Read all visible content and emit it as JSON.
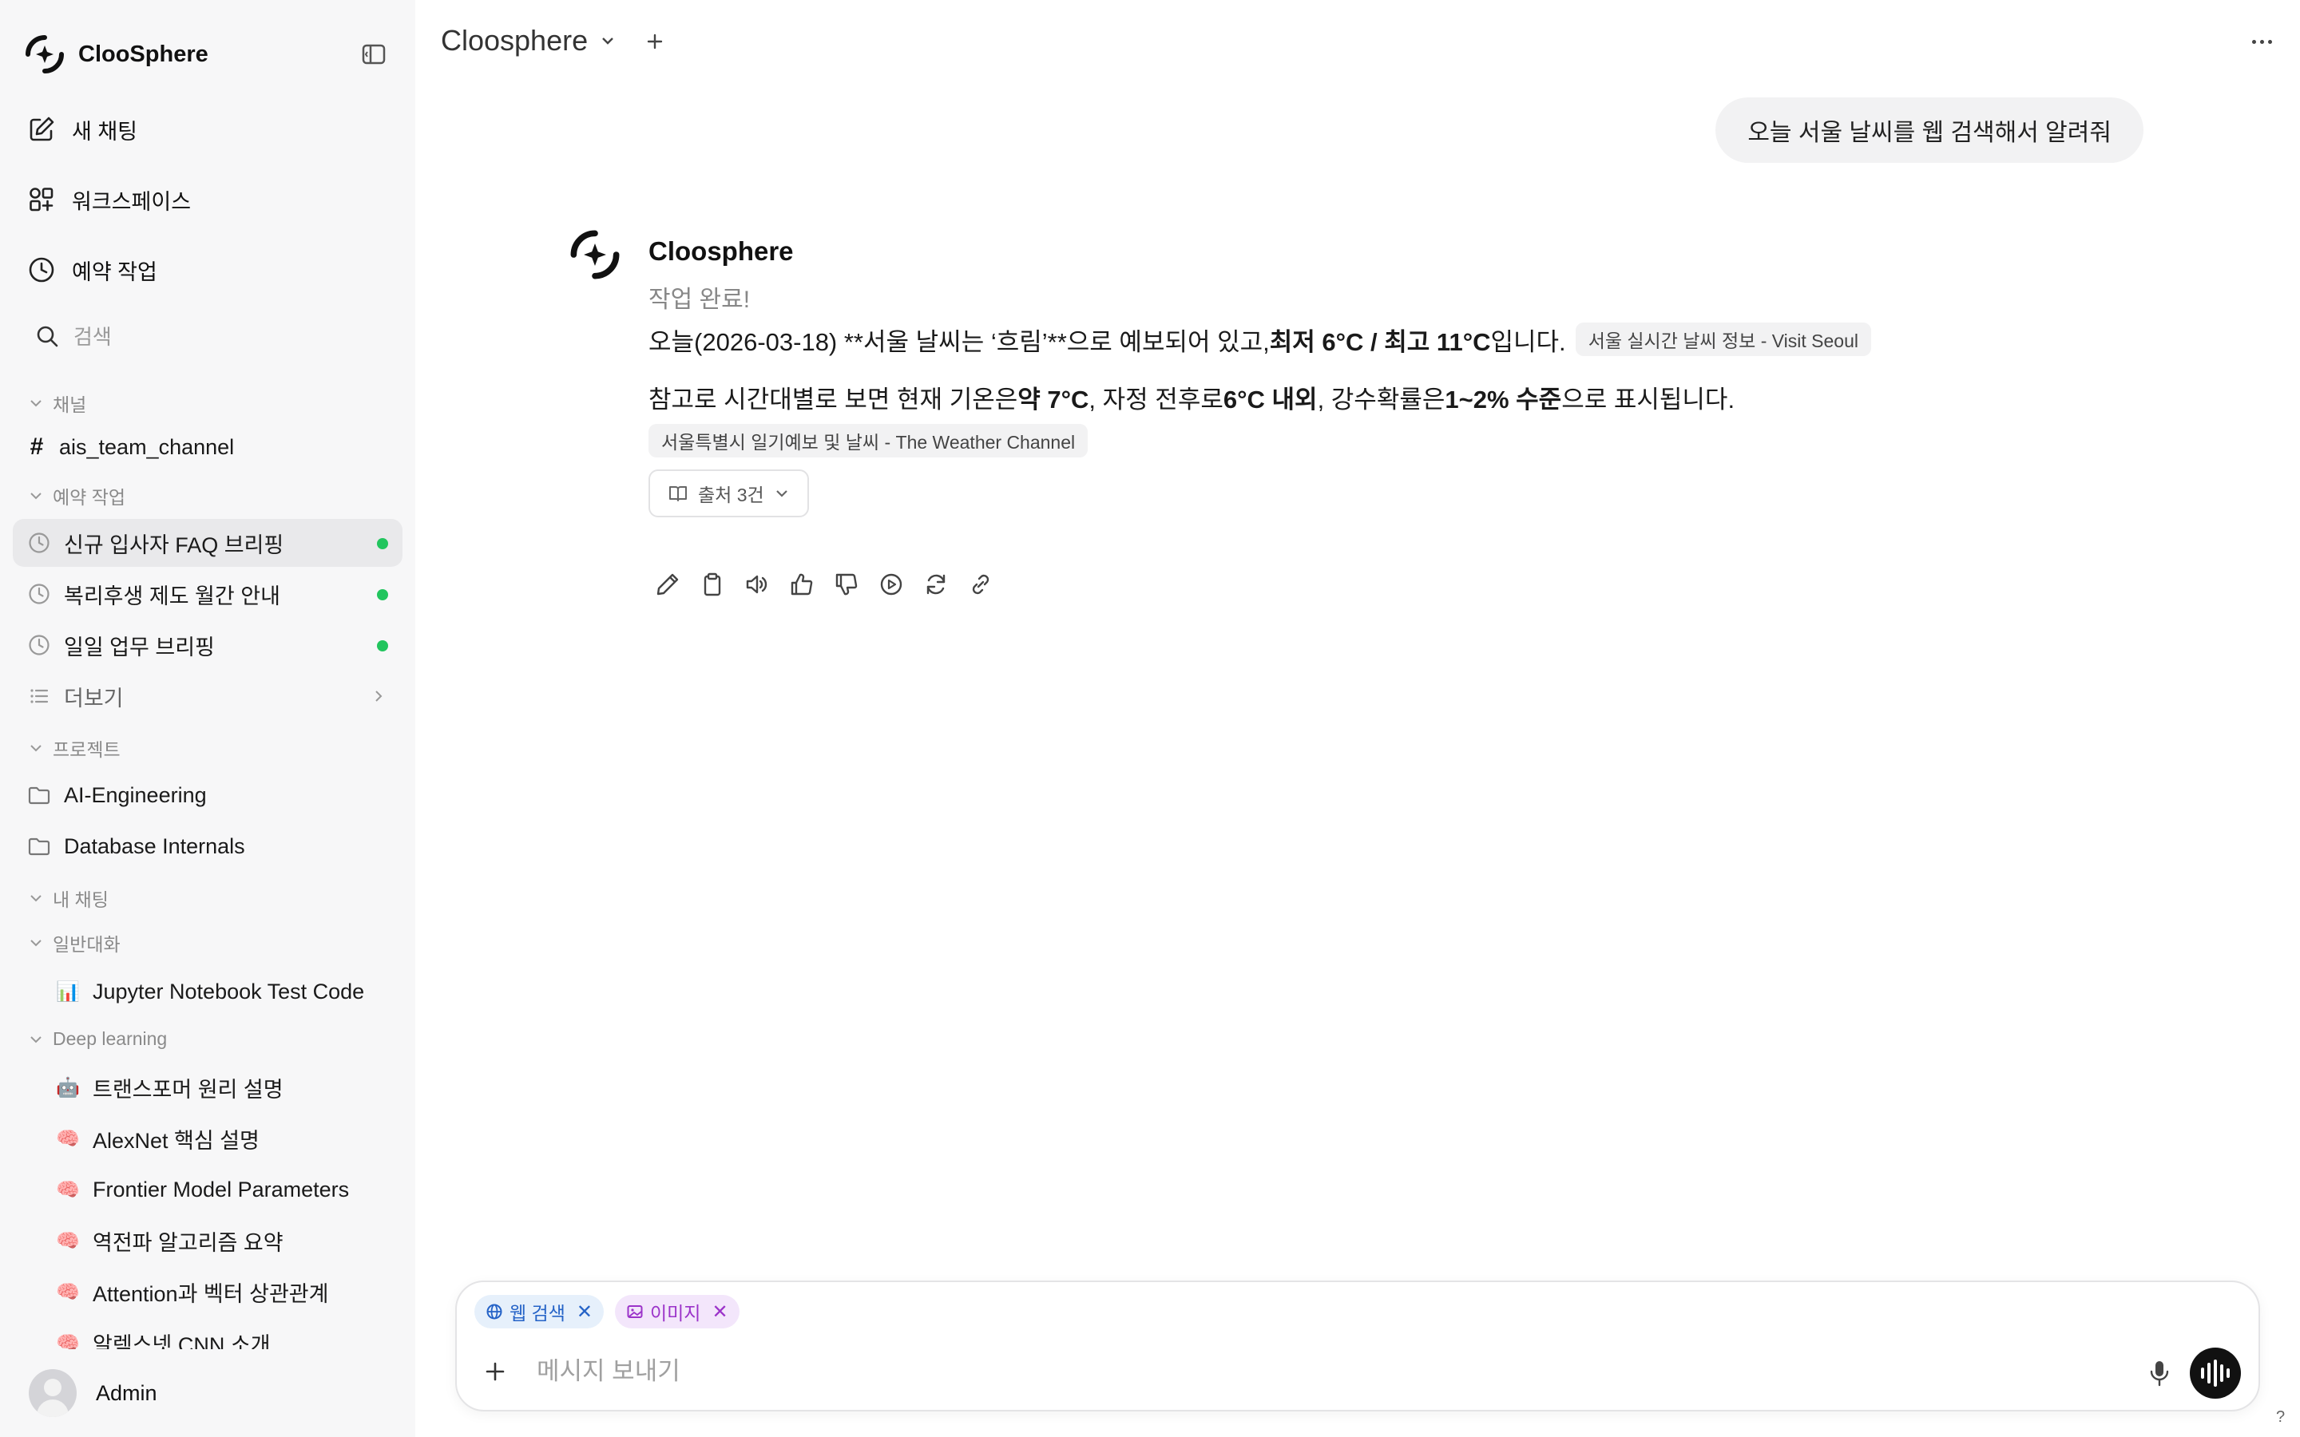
{
  "sidebar": {
    "brand": "ClooSphere",
    "nav": {
      "new_chat": "새 채팅",
      "workspace": "워크스페이스",
      "scheduled": "예약 작업"
    },
    "search_placeholder": "검색",
    "sections": {
      "channels": "채널",
      "scheduled": "예약 작업",
      "projects": "프로젝트",
      "my_chats": "내 채팅",
      "general": "일반대화",
      "deep_learning": "Deep learning"
    },
    "channels": [
      "ais_team_channel"
    ],
    "scheduled_items": [
      "신규 입사자 FAQ 브리핑",
      "복리후생 제도 월간 안내",
      "일일 업무 브리핑"
    ],
    "more": "더보기",
    "projects": [
      "AI-Engineering",
      "Database Internals"
    ],
    "general_chats": [
      {
        "emoji": "📊",
        "title": "Jupyter Notebook Test Code"
      }
    ],
    "deep_learning_chats": [
      {
        "emoji": "🤖",
        "title": "트랜스포머 원리 설명"
      },
      {
        "emoji": "🧠",
        "title": "AlexNet 핵심 설명"
      },
      {
        "emoji": "🧠",
        "title": "Frontier Model Parameters"
      },
      {
        "emoji": "🧠",
        "title": "역전파 알고리즘 요약"
      },
      {
        "emoji": "🧠",
        "title": "Attention과 벡터 상관관계"
      },
      {
        "emoji": "🧠",
        "title": "알렉스넷 CNN 소개"
      }
    ],
    "user": "Admin",
    "status_color": "#22c55e"
  },
  "header": {
    "model": "Cloosphere"
  },
  "chat": {
    "user_message": "오늘 서울 날씨를 웹 검색해서 알려줘",
    "assistant_name": "Cloosphere",
    "status": "작업 완료!",
    "para1": {
      "pre": "오늘(2026-03-18) **서울 날씨는 ‘흐림’**으로 예보되어 있고, ",
      "bold": "최저 6°C / 최고 11°C",
      "post": "입니다.",
      "cite": "서울 실시간 날씨 정보 - Visit Seoul"
    },
    "para2": {
      "t1": "참고로 시간대별로 보면 현재 기온은 ",
      "b1": "약 7°C",
      "t2": ", 자정 전후로 ",
      "b2": "6°C 내외",
      "t3": ", 강수확률은 ",
      "b3": "1~2% 수준",
      "t4": "으로 표시됩니다."
    },
    "cite2": "서울특별시 일기예보 및 날씨 - The Weather Channel",
    "sources": "출처 3건"
  },
  "composer": {
    "chips": {
      "web_search": "웹 검색",
      "image": "이미지"
    },
    "placeholder": "메시지 보내기"
  },
  "help": "?"
}
